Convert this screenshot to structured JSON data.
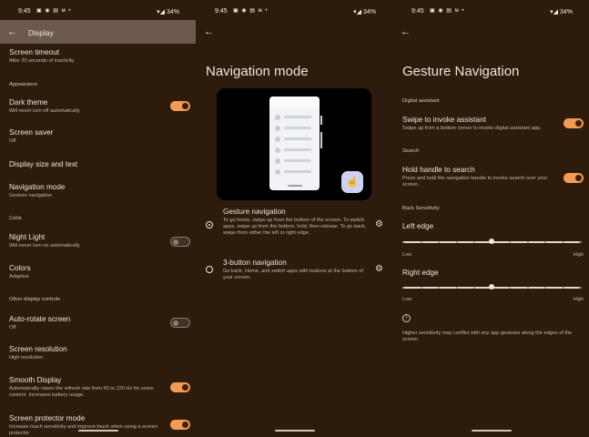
{
  "status": {
    "time": "9:45",
    "icons": "▣ ◉ ▤ ᴍ •",
    "right": "▾◢ 34%"
  },
  "panel1": {
    "title": "Display",
    "screen_timeout": {
      "title": "Screen timeout",
      "subtitle": "After 30 seconds of inactivity"
    },
    "section_appearance": "Appearance",
    "dark_theme": {
      "title": "Dark theme",
      "subtitle": "Will never turn off automatically",
      "on": true
    },
    "screen_saver": {
      "title": "Screen saver",
      "subtitle": "Off"
    },
    "display_size": {
      "title": "Display size and text"
    },
    "navigation_mode": {
      "title": "Navigation mode",
      "subtitle": "Gesture navigation"
    },
    "section_color": "Color",
    "night_light": {
      "title": "Night Light",
      "subtitle": "Will never turn on automatically",
      "on": false
    },
    "colors": {
      "title": "Colors",
      "subtitle": "Adaptive"
    },
    "section_other": "Other display controls",
    "auto_rotate": {
      "title": "Auto-rotate screen",
      "subtitle": "Off",
      "on": false
    },
    "screen_resolution": {
      "title": "Screen resolution",
      "subtitle": "High resolution"
    },
    "smooth_display": {
      "title": "Smooth Display",
      "subtitle": "Automatically raises the refresh rate from 60 to 120 Hz for some content. Increases battery usage.",
      "on": true
    },
    "screen_protector": {
      "title": "Screen protector mode",
      "subtitle": "Increase touch sensitivity and improve touch when using a screen protector",
      "on": true
    }
  },
  "panel2": {
    "title": "Navigation mode",
    "gesture_option": {
      "title": "Gesture navigation",
      "subtitle": "To go home, swipe up from the bottom of the screen. To switch apps, swipe up from the bottom, hold, then release. To go back, swipe from either the left or right edge.",
      "selected": true
    },
    "button_option": {
      "title": "3-button navigation",
      "subtitle": "Go back, Home, and switch apps with buttons at the bottom of your screen.",
      "selected": false
    }
  },
  "panel3": {
    "title": "Gesture Navigation",
    "section_assistant": "Digital assistant",
    "swipe_assistant": {
      "title": "Swipe to invoke assistant",
      "subtitle": "Swipe up from a bottom corner to invoke digital assistant app.",
      "on": true
    },
    "section_search": "Search",
    "hold_handle": {
      "title": "Hold handle to search",
      "subtitle": "Press and hold the navigation handle to invoke search over your screen.",
      "on": true
    },
    "section_sensitivity": "Back Sensitivity",
    "left_edge": {
      "title": "Left edge",
      "low": "Low",
      "high": "High",
      "value_fraction": 0.5
    },
    "right_edge": {
      "title": "Right edge",
      "low": "Low",
      "high": "High",
      "value_fraction": 0.5
    },
    "info_text": "Higher sensitivity may conflict with any app gestures along the edges of the screen."
  }
}
